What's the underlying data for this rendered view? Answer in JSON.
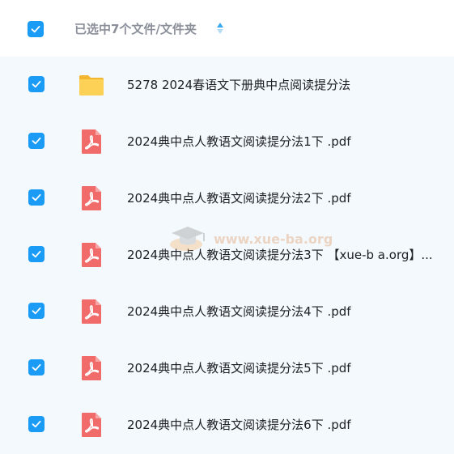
{
  "header": {
    "select_all_checked": true,
    "label": "已选中7个文件/文件夹"
  },
  "files": [
    {
      "name": "5278 2024春语文下册典中点阅读提分法",
      "type": "folder",
      "checked": true
    },
    {
      "name": "2024典中点人教语文阅读提分法1下 .pdf",
      "type": "pdf",
      "checked": true
    },
    {
      "name": "2024典中点人教语文阅读提分法2下 .pdf",
      "type": "pdf",
      "checked": true
    },
    {
      "name": "2024典中点人教语文阅读提分法3下 【xue-b a.org】...",
      "type": "pdf",
      "checked": true
    },
    {
      "name": "2024典中点人教语文阅读提分法4下 .pdf",
      "type": "pdf",
      "checked": true
    },
    {
      "name": "2024典中点人教语文阅读提分法5下 .pdf",
      "type": "pdf",
      "checked": true
    },
    {
      "name": "2024典中点人教语文阅读提分法6下 .pdf",
      "type": "pdf",
      "checked": true
    }
  ],
  "watermark": {
    "text": "www.xue-ba.org"
  },
  "colors": {
    "checkbox": "#1a9bf5",
    "list_background": "#f3f9fd",
    "folder": "#f9c23c",
    "pdf": "#f26b6b"
  }
}
